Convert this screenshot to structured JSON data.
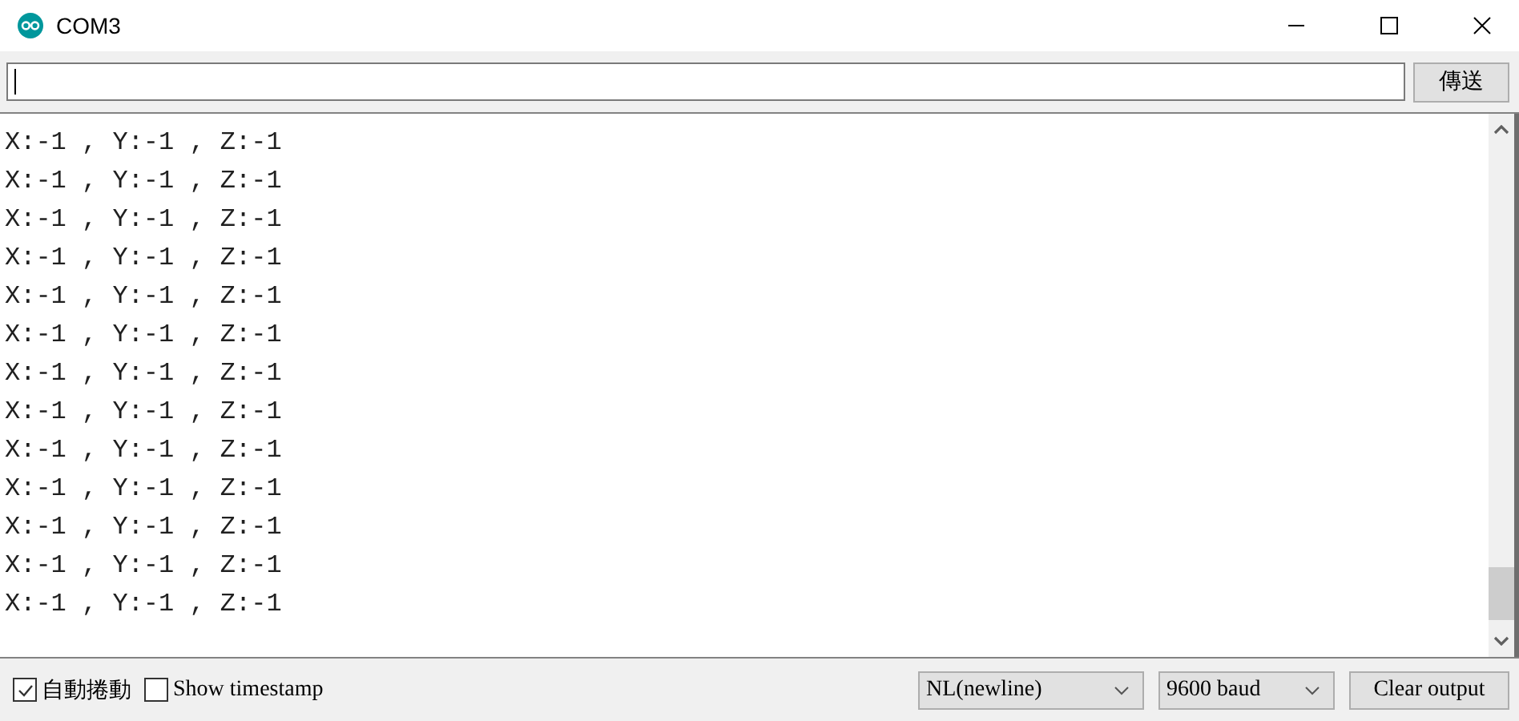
{
  "window": {
    "title": "COM3"
  },
  "input": {
    "send_button": "傳送"
  },
  "output_lines": [
    "X:-1 , Y:-1 , Z:-1",
    "X:-1 , Y:-1 , Z:-1",
    "X:-1 , Y:-1 , Z:-1",
    "X:-1 , Y:-1 , Z:-1",
    "X:-1 , Y:-1 , Z:-1",
    "X:-1 , Y:-1 , Z:-1",
    "X:-1 , Y:-1 , Z:-1",
    "X:-1 , Y:-1 , Z:-1",
    "X:-1 , Y:-1 , Z:-1",
    "X:-1 , Y:-1 , Z:-1",
    "X:-1 , Y:-1 , Z:-1",
    "X:-1 , Y:-1 , Z:-1",
    "X:-1 , Y:-1 , Z:-1"
  ],
  "footer": {
    "checkboxes": [
      {
        "label": "自動捲動",
        "checked": true
      },
      {
        "label": "Show timestamp",
        "checked": false
      }
    ],
    "line_ending": "NL(newline)",
    "baud": "9600 baud",
    "clear_button": "Clear output"
  }
}
